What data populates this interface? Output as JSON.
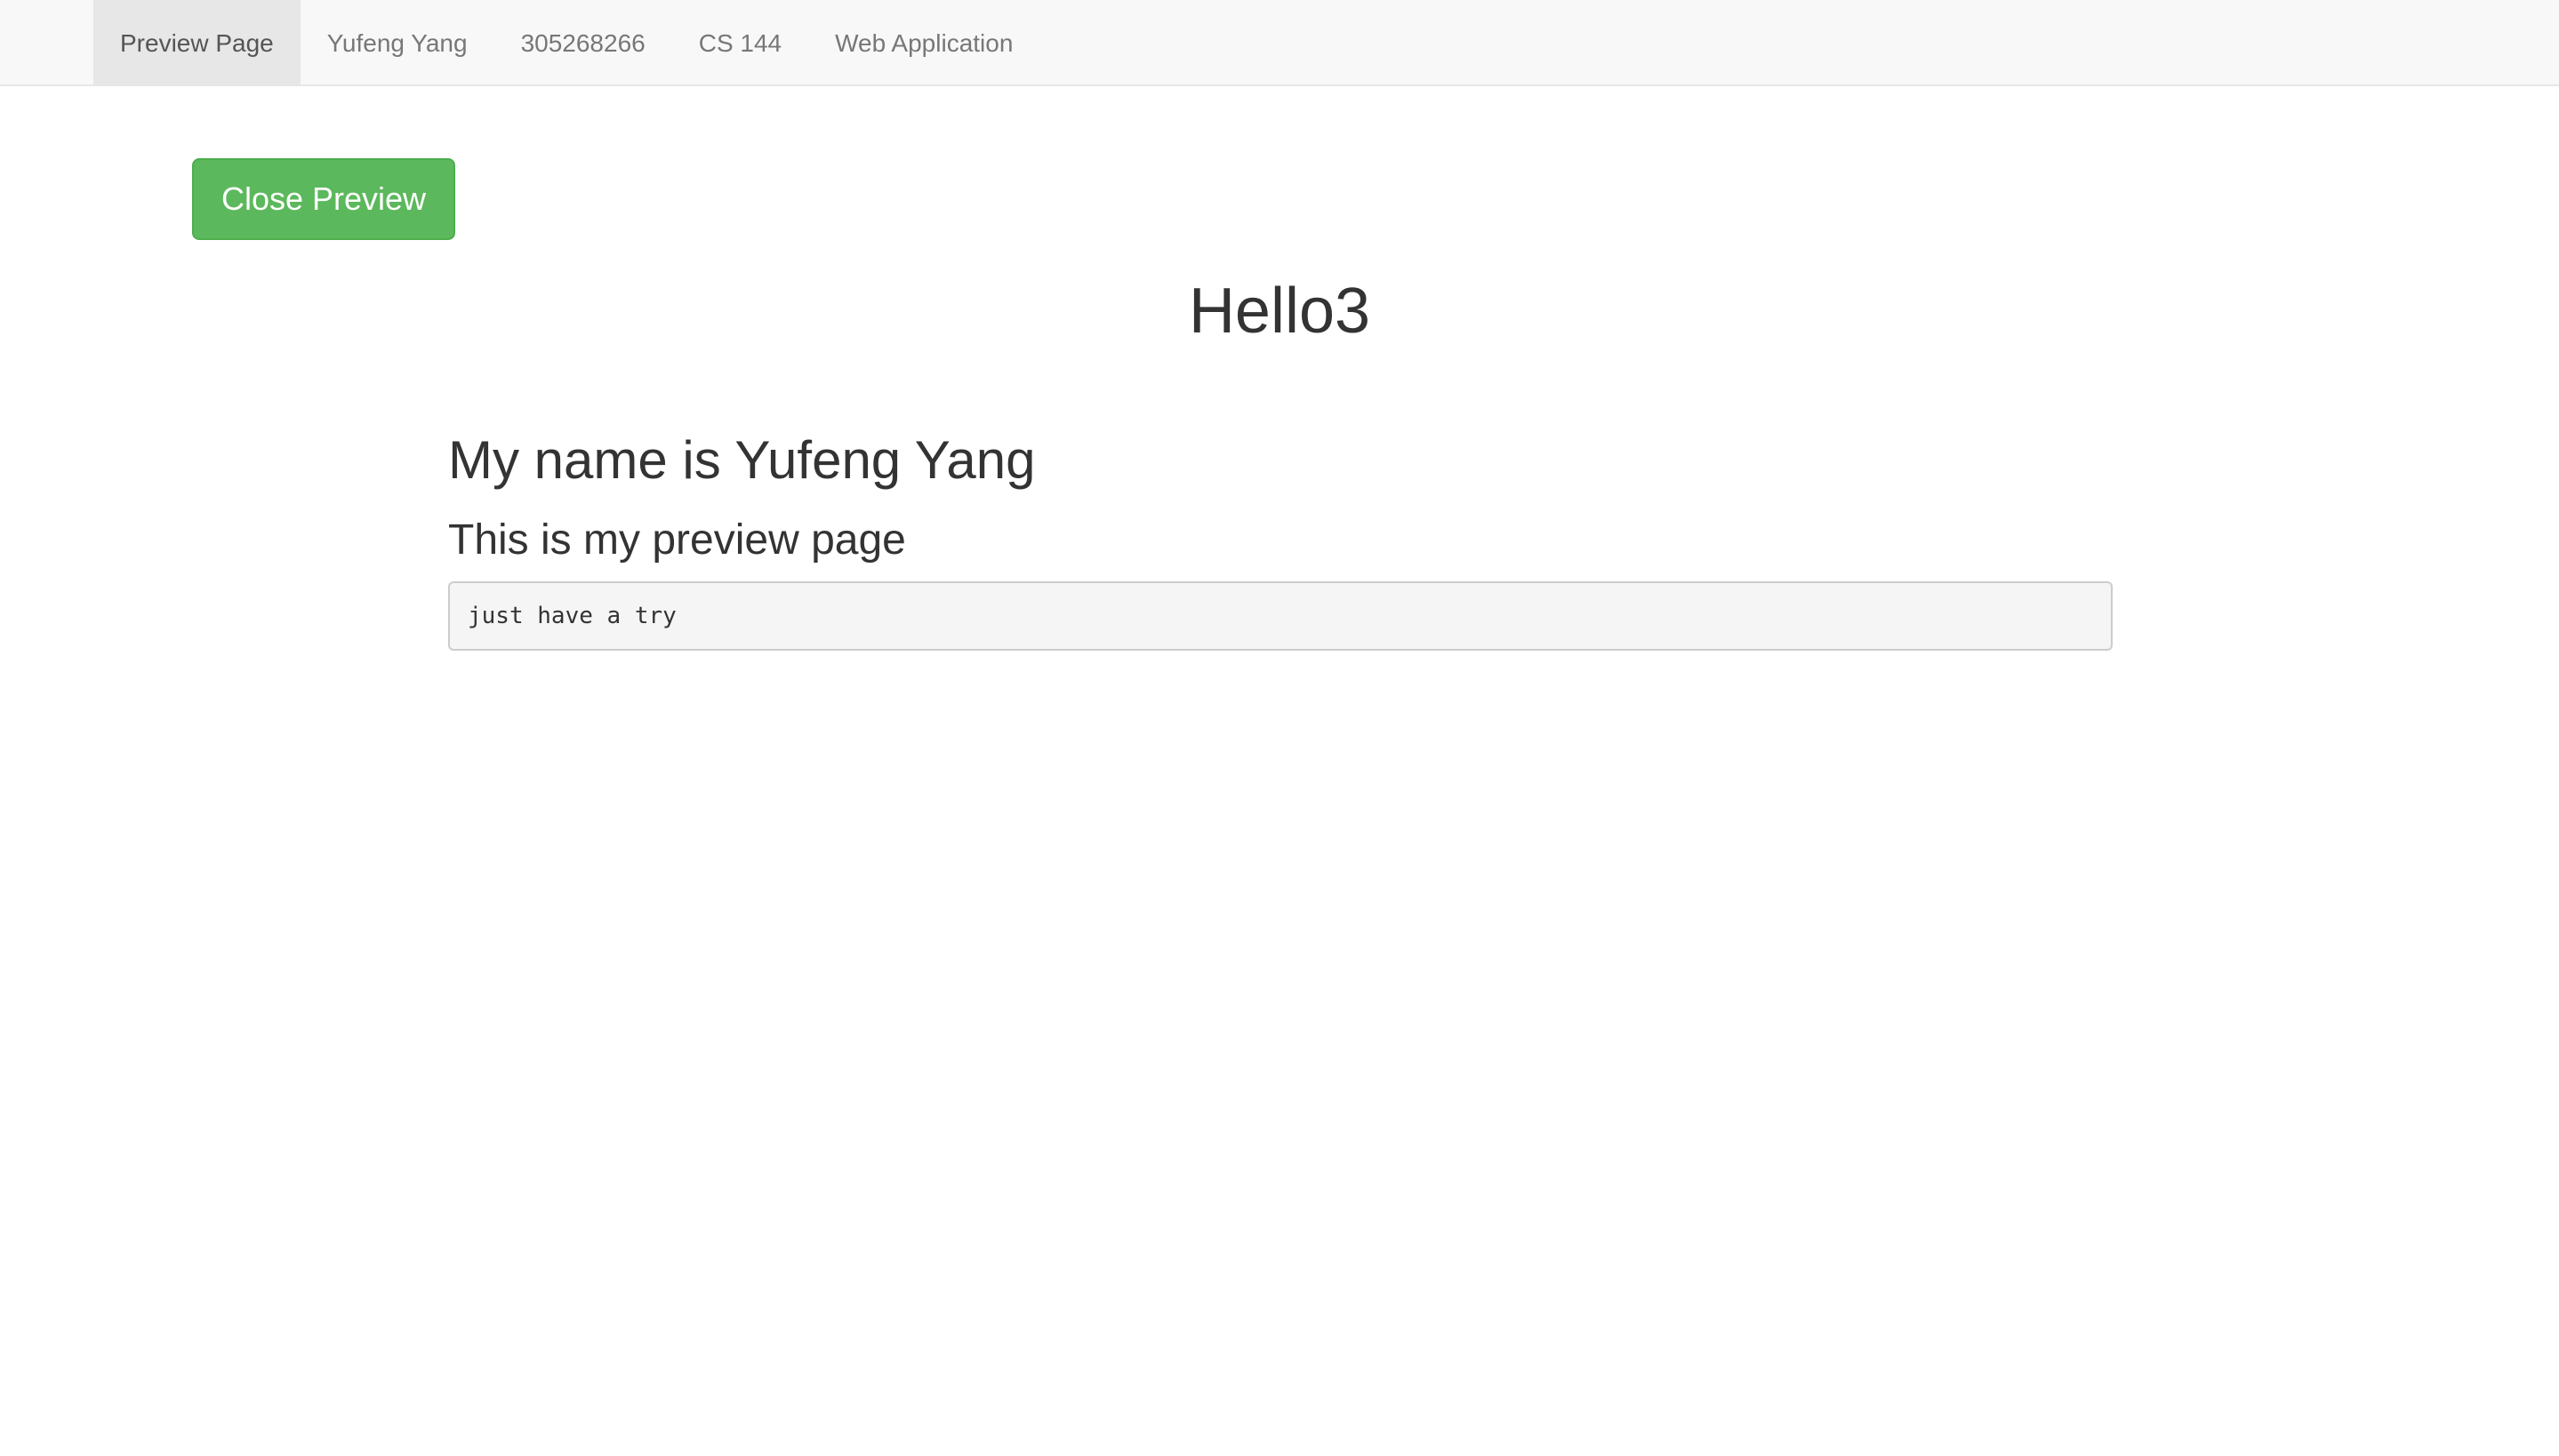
{
  "navbar": {
    "items": [
      {
        "label": "Preview Page",
        "active": true
      },
      {
        "label": "Yufeng Yang",
        "active": false
      },
      {
        "label": "305268266",
        "active": false
      },
      {
        "label": "CS 144",
        "active": false
      },
      {
        "label": "Web Application",
        "active": false
      }
    ]
  },
  "close_button": {
    "label": "Close Preview",
    "color": "#5cb85c"
  },
  "page": {
    "title": "Hello3",
    "heading": "My name is Yufeng Yang",
    "subheading": "This is my preview page",
    "code_text": "just have a try"
  }
}
